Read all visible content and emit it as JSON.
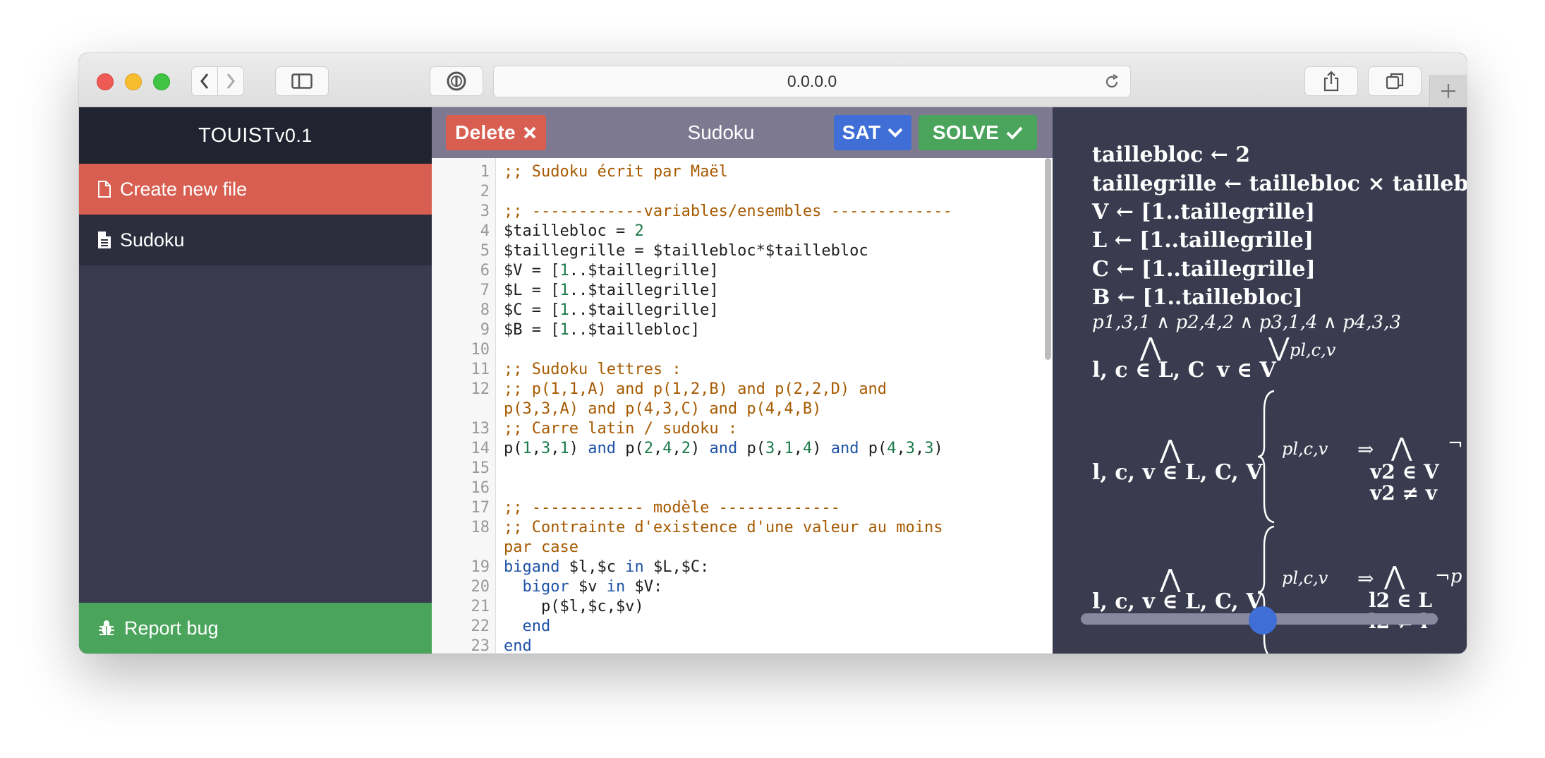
{
  "browser": {
    "url": "0.0.0.0"
  },
  "sidebar": {
    "brand": "TOUIST",
    "version": "v0.1",
    "create_label": "Create new file",
    "file_label": "Sudoku",
    "bug_label": "Report bug"
  },
  "editor": {
    "delete_label": "Delete",
    "title": "Sudoku",
    "solver_label": "SAT",
    "solve_label": "SOLVE",
    "lines": [
      {
        "n": "1",
        "text": ";; Sudoku écrit par Maël"
      },
      {
        "n": "2",
        "text": ""
      },
      {
        "n": "3",
        "text": ";; ------------variables/ensembles -------------"
      },
      {
        "n": "4",
        "text": "$taillebloc = 2"
      },
      {
        "n": "5",
        "text": "$taillegrille = $taillebloc*$taillebloc"
      },
      {
        "n": "6",
        "text": "$V = [1..$taillegrille]"
      },
      {
        "n": "7",
        "text": "$L = [1..$taillegrille]"
      },
      {
        "n": "8",
        "text": "$C = [1..$taillegrille]"
      },
      {
        "n": "9",
        "text": "$B = [1..$taillebloc]"
      },
      {
        "n": "10",
        "text": ""
      },
      {
        "n": "11",
        "text": ";; Sudoku lettres :"
      },
      {
        "n": "12",
        "text": ";; p(1,1,A) and p(1,2,B) and p(2,2,D) and"
      },
      {
        "n": "",
        "text": "p(3,3,A) and p(4,3,C) and p(4,4,B)"
      },
      {
        "n": "13",
        "text": ";; Carre latin / sudoku :"
      },
      {
        "n": "14",
        "text": "p(1,3,1) and p(2,4,2) and p(3,1,4) and p(4,3,3)"
      },
      {
        "n": "15",
        "text": ""
      },
      {
        "n": "16",
        "text": ""
      },
      {
        "n": "17",
        "text": ";; ------------ modèle -------------"
      },
      {
        "n": "18",
        "text": ";; Contrainte d'existence d'une valeur au moins"
      },
      {
        "n": "",
        "text": "par case"
      },
      {
        "n": "19",
        "text": "bigand $l,$c in $L,$C:"
      },
      {
        "n": "20",
        "text": "  bigor $v in $V:"
      },
      {
        "n": "21",
        "text": "    p($l,$c,$v)"
      },
      {
        "n": "22",
        "text": "  end"
      },
      {
        "n": "23",
        "text": "end"
      }
    ]
  },
  "output": {
    "lines": [
      "taillebloc ← 2",
      "taillegrille ← taillebloc × taillebloc",
      "V ← [1..taillegrille]",
      "L ← [1..taillegrille]",
      "C ← [1..taillegrille]",
      "B ← [1..taillebloc]"
    ],
    "facts": "p1,3,1 ∧ p2,4,2 ∧ p3,1,4 ∧ p4,3,3",
    "bigand_index_1": "l, c ∈ L, C",
    "bigor_index_1": "v ∈ V",
    "prop_lcv": "pl,c,v",
    "bigand_index_2": "l, c, v ∈ L, C, V",
    "bigand_sub_2a": "v2 ∈ V",
    "bigand_sub_2b": "v2 ≠ v",
    "bigand_index_3": "l, c, v ∈ L, C, V",
    "bigand_sub_3a": "l2 ∈ L",
    "bigand_sub_3b": "l2 ≠ l",
    "neg_tail_2": "¬",
    "neg_tail_3": "¬p",
    "horizontal_scroll_fraction": 0.5
  }
}
